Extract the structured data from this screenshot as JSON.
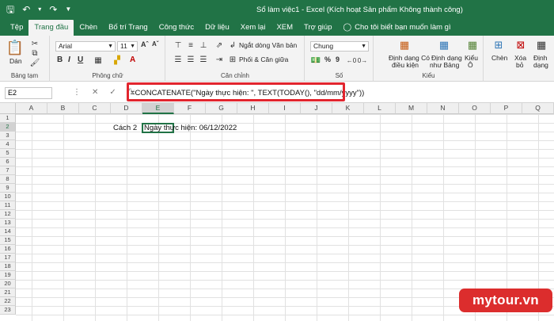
{
  "window": {
    "title": "Sổ làm việc1  -  Excel (Kích hoạt Sản phẩm Không thành công)"
  },
  "tabs": [
    "Tệp",
    "Trang đầu",
    "Chèn",
    "Bố trí Trang",
    "Công thức",
    "Dữ liệu",
    "Xem lại",
    "XEM",
    "Trợ giúp",
    "Cho tôi biết bạn muốn làm gì"
  ],
  "active_tab": "Trang đầu",
  "ribbon": {
    "clipboard": {
      "paste_label": "Dán",
      "group_label": "Bảng tạm"
    },
    "font": {
      "font_name": "Arial",
      "font_size": "11",
      "group_label": "Phông chữ"
    },
    "alignment": {
      "wrap_text": "Ngắt dòng Văn bản",
      "merge_center": "Phối & Căn giữa",
      "group_label": "Căn chỉnh"
    },
    "number": {
      "format": "Chung",
      "group_label": "Số"
    },
    "styles": {
      "conditional_1": "Định dạng Có",
      "conditional_2": "điều kiện",
      "table_1": "Định dạng",
      "table_2": "như Bảng",
      "cell_styles_1": "Kiểu",
      "cell_styles_2": "Ô",
      "group_label": "Kiểu"
    },
    "cells": {
      "insert": "Chèn",
      "delete_1": "Xóa",
      "delete_2": "bỏ",
      "format_1": "Định",
      "format_2": "dạng"
    }
  },
  "formula_bar": {
    "name_box": "E2",
    "fx": "fx",
    "formula": "=CONCATENATE(\"Ngày thực hiện: \", TEXT(TODAY(), \"dd/mm/yyyy\"))"
  },
  "columns": [
    "A",
    "B",
    "C",
    "D",
    "E",
    "F",
    "G",
    "H",
    "I",
    "J",
    "K",
    "L",
    "M",
    "N",
    "O",
    "P",
    "Q"
  ],
  "rows": [
    "1",
    "2",
    "3",
    "4",
    "5",
    "6",
    "7",
    "8",
    "9",
    "10",
    "11",
    "12",
    "13",
    "14",
    "15",
    "16",
    "17",
    "18",
    "19",
    "20",
    "21",
    "22",
    "23"
  ],
  "cells": {
    "D2": "Cách 2",
    "E2": "Ngày thực hiện: 06/12/2022"
  },
  "watermark": "mytour.vn"
}
